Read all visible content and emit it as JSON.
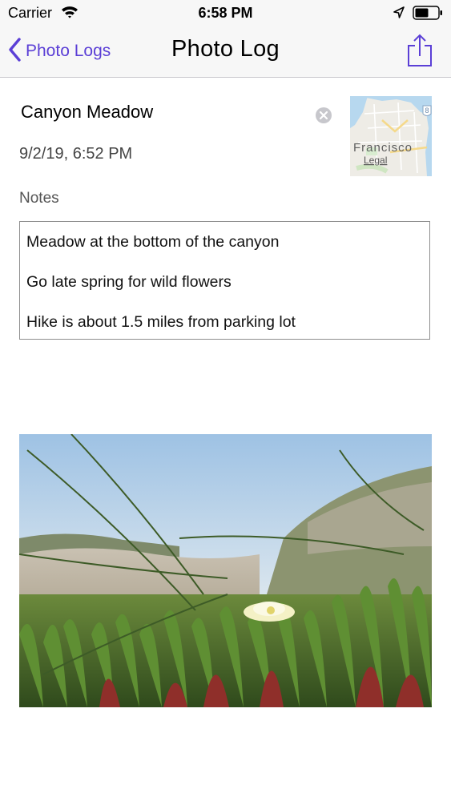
{
  "status_bar": {
    "carrier": "Carrier",
    "time": "6:58 PM",
    "icons": [
      "wifi-icon",
      "location-arrow-icon",
      "battery-icon"
    ]
  },
  "nav": {
    "back_label": "Photo Logs",
    "title": "Photo Log",
    "share_icon": "share-icon",
    "accent_color": "#5b3fd6"
  },
  "entry": {
    "title": "Canyon Meadow",
    "date": "9/2/19, 6:52 PM"
  },
  "map": {
    "place_label": "Francisco",
    "legal_label": "Legal",
    "route_badge": "8"
  },
  "notes": {
    "heading": "Notes",
    "lines": [
      "Meadow at the bottom of the canyon",
      "Go late spring for wild flowers",
      "Hike is about 1.5 miles from parking lot"
    ]
  },
  "photo": {
    "subject": "ice plant meadow with white flower"
  }
}
